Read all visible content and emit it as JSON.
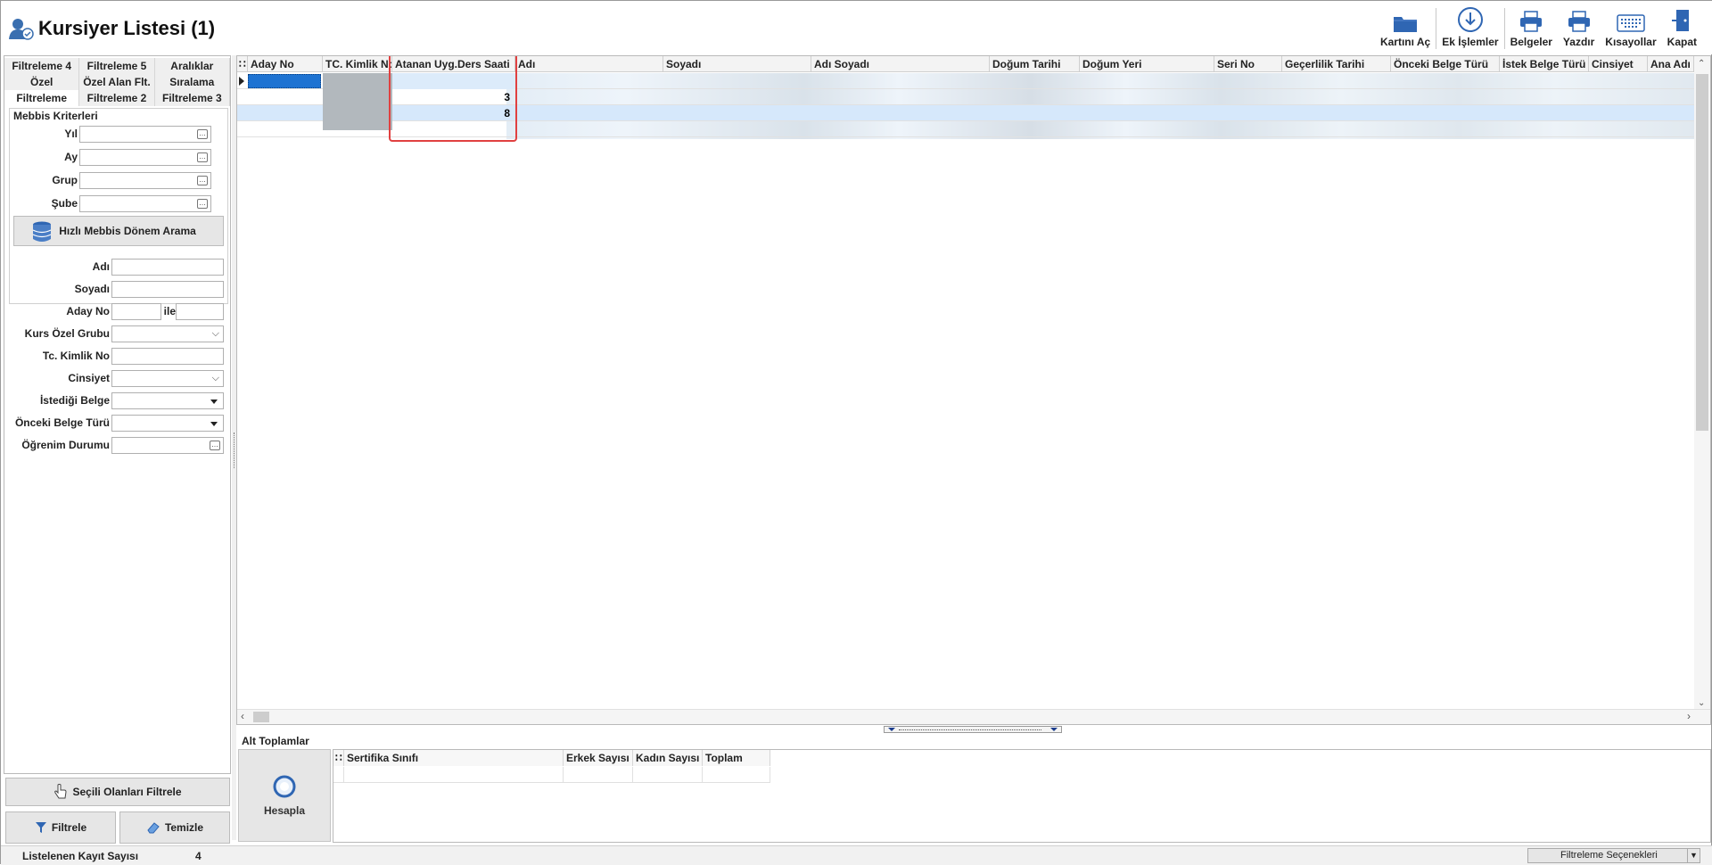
{
  "window": {
    "title": "Kursiyer Listesi (1)"
  },
  "toolbar": [
    {
      "label": "Kartını Aç",
      "icon": "folder-icon"
    },
    {
      "label": "Ek İşlemler",
      "icon": "download-circle-icon"
    },
    {
      "label": "Belgeler",
      "icon": "printer-icon"
    },
    {
      "label": "Yazdır",
      "icon": "printer-icon"
    },
    {
      "label": "Kısayollar",
      "icon": "keyboard-icon"
    },
    {
      "label": "Kapat",
      "icon": "exit-door-icon"
    }
  ],
  "left": {
    "tabs_row1": [
      "Filtreleme 4",
      "Filtreleme 5",
      "Aralıklar"
    ],
    "tabs_row2": [
      "Özel",
      "Özel Alan Flt.",
      "Sıralama"
    ],
    "tabs_row3": [
      "Filtreleme",
      "Filtreleme 2",
      "Filtreleme 3"
    ],
    "group_title": "Mebbis Kriterleri",
    "mebbis_fields": [
      "Yıl",
      "Ay",
      "Grup",
      "Şube"
    ],
    "mebbis_button": "Hızlı Mebbis Dönem Arama",
    "fields": {
      "adi": "Adı",
      "soyadi": "Soyadı",
      "aday_no": "Aday No",
      "ile": "ile",
      "kurs_ozel_grubu": "Kurs Özel Grubu",
      "tc_kimlik": "Tc. Kimlik No",
      "cinsiyet": "Cinsiyet",
      "istedigi_belge": "İstediği Belge",
      "onceki_belge": "Önceki Belge Türü",
      "ogrenim": "Öğrenim Durumu"
    },
    "selected_filter_button": "Seçili Olanları Filtrele",
    "filter_button": "Filtrele",
    "clear_button": "Temizle"
  },
  "grid": {
    "columns": [
      "Aday No",
      "TC. Kimlik No",
      "Atanan Uyg.Ders Saati",
      "Adı",
      "Soyadı",
      "Adı Soyadı",
      "Doğum Tarihi",
      "Doğum Yeri",
      "Seri No",
      "Geçerlilik Tarihi",
      "Önceki Belge Türü",
      "İstek Belge Türü",
      "Cinsiyet",
      "Ana Adı"
    ],
    "rows": [
      {
        "ders_saati": ""
      },
      {
        "ders_saati": "3"
      },
      {
        "ders_saati": "8"
      },
      {
        "ders_saati": ""
      }
    ]
  },
  "totals": {
    "title": "Alt Toplamlar",
    "button": "Hesapla",
    "columns": [
      "Sertifika Sınıfı",
      "Erkek Sayısı",
      "Kadın Sayısı",
      "Toplam"
    ]
  },
  "status": {
    "label": "Listelenen Kayıt Sayısı",
    "count": "4",
    "filter_options": "Filtreleme Seçenekleri"
  },
  "colors": {
    "accent": "#1e73d2",
    "highlight_border": "#e04040",
    "selected_row": "#d6e8fb"
  }
}
